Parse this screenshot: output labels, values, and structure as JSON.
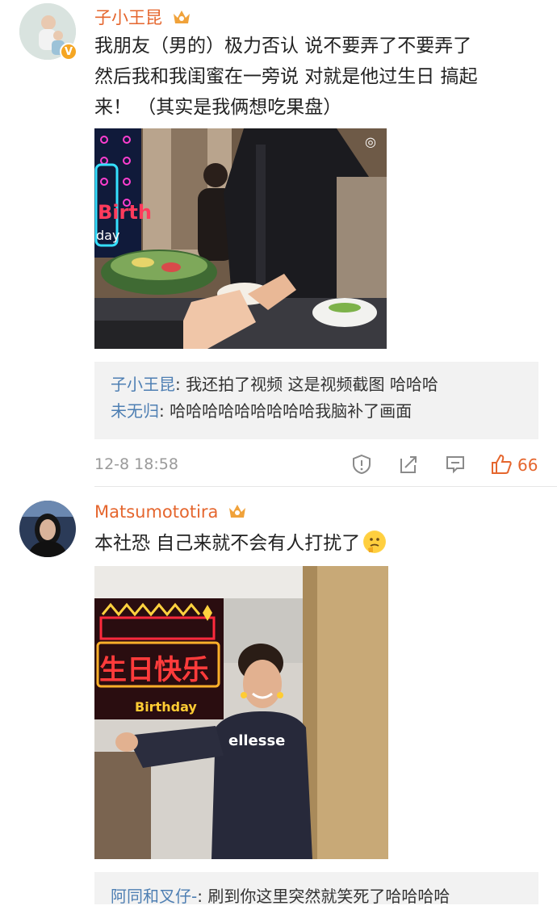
{
  "comments": [
    {
      "username": "子小王昆",
      "text": [
        "我朋友（男的）极力否认 说不要弄了不要弄了",
        "然后我和我闺蜜在一旁说 对就是他过生日 搞起",
        "来！  （其实是我俩想吃果盘）"
      ],
      "replies": [
        {
          "name": "子小王昆",
          "text": "我还拍了视频 这是视频截图 哈哈哈"
        },
        {
          "name": "未无归",
          "text": "哈哈哈哈哈哈哈哈哈我脑补了画面"
        }
      ],
      "time": "12-8 18:58",
      "likes": "66"
    },
    {
      "username": "Matsumototira",
      "text": "本社恐 自己来就不会有人打扰了",
      "replies": [
        {
          "name": "阿同和叉仔-",
          "text": "刷到你这里突然就笑死了哈哈哈哈"
        }
      ]
    }
  ],
  "sign1": {
    "l1": "Birth",
    "l2": "day"
  },
  "sign2": {
    "chars": "生日快乐",
    "sub": "Birthday"
  },
  "shirt_logo": "ellesse",
  "colors": {
    "accent": "#e5662e",
    "link": "#4e7fb3",
    "muted": "#9a9a9a",
    "reply_bg": "#f2f2f2"
  }
}
